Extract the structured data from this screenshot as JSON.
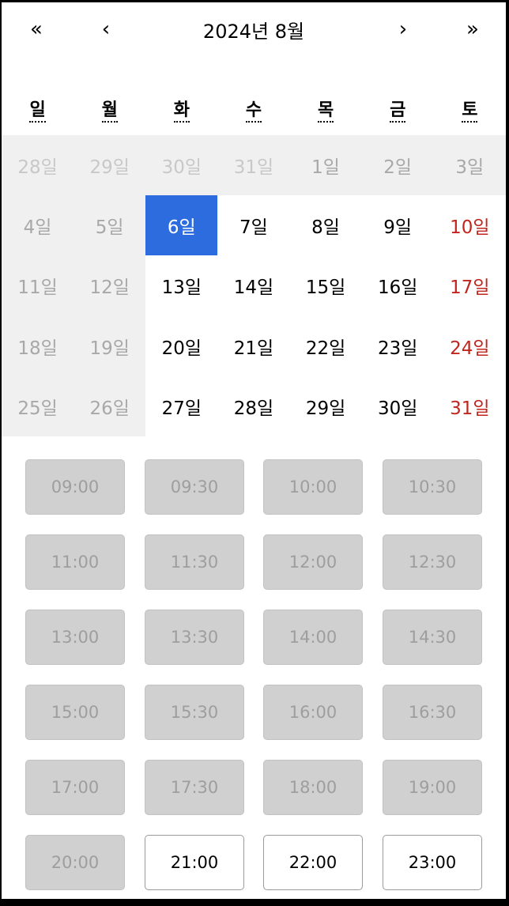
{
  "header": {
    "prev_year": "«",
    "prev_month": "‹",
    "title": "2024년 8월",
    "next_month": "›",
    "next_year": "»"
  },
  "weekdays": [
    "일",
    "월",
    "화",
    "수",
    "목",
    "금",
    "토"
  ],
  "weeks": [
    [
      {
        "label": "28일",
        "state": "neighbor"
      },
      {
        "label": "29일",
        "state": "neighbor"
      },
      {
        "label": "30일",
        "state": "neighbor"
      },
      {
        "label": "31일",
        "state": "neighbor"
      },
      {
        "label": "1일",
        "state": "disabled"
      },
      {
        "label": "2일",
        "state": "disabled"
      },
      {
        "label": "3일",
        "state": "disabled"
      }
    ],
    [
      {
        "label": "4일",
        "state": "disabled"
      },
      {
        "label": "5일",
        "state": "disabled"
      },
      {
        "label": "6일",
        "state": "selected"
      },
      {
        "label": "7일",
        "state": "available"
      },
      {
        "label": "8일",
        "state": "available"
      },
      {
        "label": "9일",
        "state": "available"
      },
      {
        "label": "10일",
        "state": "weekend"
      }
    ],
    [
      {
        "label": "11일",
        "state": "disabled"
      },
      {
        "label": "12일",
        "state": "disabled"
      },
      {
        "label": "13일",
        "state": "available"
      },
      {
        "label": "14일",
        "state": "available"
      },
      {
        "label": "15일",
        "state": "available"
      },
      {
        "label": "16일",
        "state": "available"
      },
      {
        "label": "17일",
        "state": "weekend"
      }
    ],
    [
      {
        "label": "18일",
        "state": "disabled"
      },
      {
        "label": "19일",
        "state": "disabled"
      },
      {
        "label": "20일",
        "state": "available"
      },
      {
        "label": "21일",
        "state": "available"
      },
      {
        "label": "22일",
        "state": "available"
      },
      {
        "label": "23일",
        "state": "available"
      },
      {
        "label": "24일",
        "state": "weekend"
      }
    ],
    [
      {
        "label": "25일",
        "state": "disabled"
      },
      {
        "label": "26일",
        "state": "disabled"
      },
      {
        "label": "27일",
        "state": "available"
      },
      {
        "label": "28일",
        "state": "available"
      },
      {
        "label": "29일",
        "state": "available"
      },
      {
        "label": "30일",
        "state": "available"
      },
      {
        "label": "31일",
        "state": "weekend"
      }
    ]
  ],
  "time_slots": [
    {
      "label": "09:00",
      "enabled": false
    },
    {
      "label": "09:30",
      "enabled": false
    },
    {
      "label": "10:00",
      "enabled": false
    },
    {
      "label": "10:30",
      "enabled": false
    },
    {
      "label": "11:00",
      "enabled": false
    },
    {
      "label": "11:30",
      "enabled": false
    },
    {
      "label": "12:00",
      "enabled": false
    },
    {
      "label": "12:30",
      "enabled": false
    },
    {
      "label": "13:00",
      "enabled": false
    },
    {
      "label": "13:30",
      "enabled": false
    },
    {
      "label": "14:00",
      "enabled": false
    },
    {
      "label": "14:30",
      "enabled": false
    },
    {
      "label": "15:00",
      "enabled": false
    },
    {
      "label": "15:30",
      "enabled": false
    },
    {
      "label": "16:00",
      "enabled": false
    },
    {
      "label": "16:30",
      "enabled": false
    },
    {
      "label": "17:00",
      "enabled": false
    },
    {
      "label": "17:30",
      "enabled": false
    },
    {
      "label": "18:00",
      "enabled": false
    },
    {
      "label": "19:00",
      "enabled": false
    },
    {
      "label": "20:00",
      "enabled": false
    },
    {
      "label": "21:00",
      "enabled": true
    },
    {
      "label": "22:00",
      "enabled": true
    },
    {
      "label": "23:00",
      "enabled": true
    }
  ],
  "colors": {
    "selected": "#2d6cdf",
    "weekend": "#c0261d",
    "disabled_bg": "#f0f0f0"
  }
}
